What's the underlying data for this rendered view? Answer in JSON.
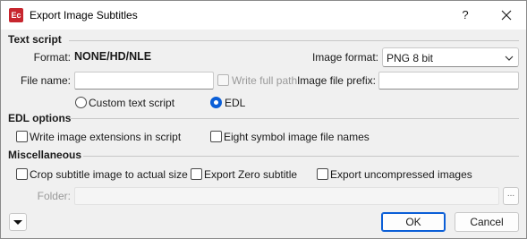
{
  "window": {
    "app_icon_text": "Ec",
    "title": "Export Image Subtitles",
    "help_label": "?",
    "close_icon": "close-icon"
  },
  "text_script": {
    "heading": "Text script",
    "format_label": "Format:",
    "format_value": "NONE/HD/NLE",
    "image_format_label": "Image format:",
    "image_format_value": "PNG 8 bit",
    "file_name_label": "File name:",
    "file_name_value": "",
    "write_full_path_label": "Write full path",
    "image_file_prefix_label": "Image file prefix:",
    "image_file_prefix_value": "",
    "radio_custom_label": "Custom text script",
    "radio_edl_label": "EDL",
    "selected": "EDL"
  },
  "edl_options": {
    "heading": "EDL options",
    "write_ext_label": "Write image extensions in script",
    "eight_symbol_label": "Eight symbol image file names"
  },
  "misc": {
    "heading": "Miscellaneous",
    "crop_label": "Crop subtitle image to actual size",
    "export_zero_label": "Export Zero subtitle",
    "export_uncompressed_label": "Export uncompressed images",
    "folder_label": "Folder:",
    "folder_value": "",
    "browse_label": "..."
  },
  "footer": {
    "ok_label": "OK",
    "cancel_label": "Cancel"
  },
  "colors": {
    "accent": "#0a5ed7",
    "app_icon": "#c7262e"
  }
}
